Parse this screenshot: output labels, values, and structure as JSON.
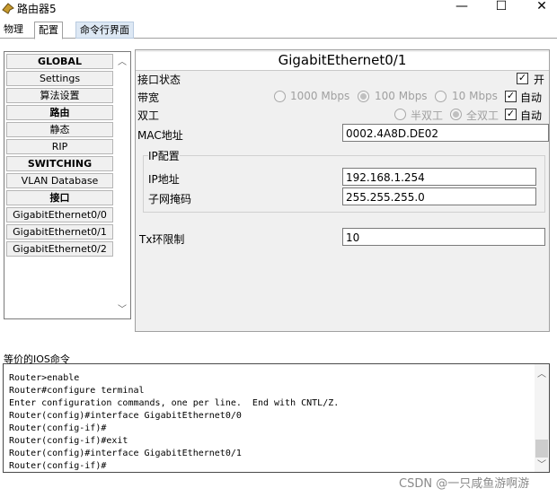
{
  "window": {
    "title": "路由器5",
    "controls": {
      "minimize": "—",
      "maximize": "☐",
      "close": "✕"
    }
  },
  "tabs": [
    "物理",
    "配置",
    "命令行界面"
  ],
  "nav": [
    {
      "label": "GLOBAL",
      "header": true
    },
    {
      "label": "Settings",
      "header": false
    },
    {
      "label": "算法设置",
      "header": false
    },
    {
      "label": "路由",
      "header": true
    },
    {
      "label": "静态",
      "header": false
    },
    {
      "label": "RIP",
      "header": false
    },
    {
      "label": "SWITCHING",
      "header": true
    },
    {
      "label": "VLAN Database",
      "header": false
    },
    {
      "label": "接口",
      "header": true
    },
    {
      "label": "GigabitEthernet0/0",
      "header": false
    },
    {
      "label": "GigabitEthernet0/1",
      "header": false
    },
    {
      "label": "GigabitEthernet0/2",
      "header": false
    }
  ],
  "config": {
    "interface_title": "GigabitEthernet0/1",
    "port_status": {
      "label": "接口状态",
      "check_label": "开",
      "checked": true
    },
    "bandwidth": {
      "label": "带宽",
      "options": [
        "1000 Mbps",
        "100 Mbps",
        "10 Mbps"
      ],
      "selected": "100 Mbps",
      "auto_label": "自动",
      "auto": true
    },
    "duplex": {
      "label": "双工",
      "options": [
        "半双工",
        "全双工"
      ],
      "selected": "全双工",
      "auto_label": "自动",
      "auto": true
    },
    "mac": {
      "label": "MAC地址",
      "value": "0002.4A8D.DE02"
    },
    "ip_group": {
      "label": "IP配置"
    },
    "ip": {
      "label": "IP地址",
      "value": "192.168.1.254"
    },
    "mask": {
      "label": "子网掩码",
      "value": "255.255.255.0"
    },
    "tx": {
      "label": "Tx环限制",
      "value": "10"
    }
  },
  "ios": {
    "label": "等价的IOS命令",
    "lines": [
      "Router>enable",
      "Router#configure terminal",
      "Enter configuration commands, one per line.  End with CNTL/Z.",
      "Router(config)#interface GigabitEthernet0/0",
      "Router(config-if)#",
      "Router(config-if)#exit",
      "Router(config)#interface GigabitEthernet0/1",
      "Router(config-if)#"
    ]
  },
  "watermark": "CSDN @一只咸鱼游啊游"
}
